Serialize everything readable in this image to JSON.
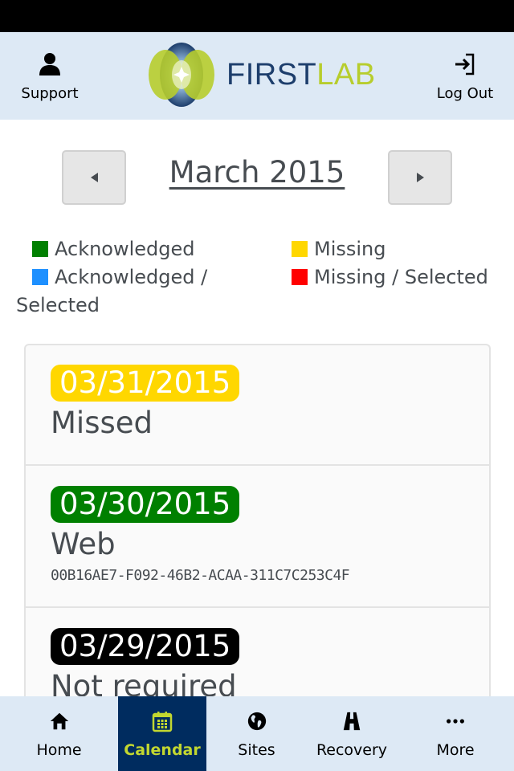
{
  "header": {
    "support_label": "Support",
    "logout_label": "Log Out",
    "logo_first": "FIRST",
    "logo_lab": "LAB"
  },
  "calendar": {
    "month_title": "March 2015",
    "prev_icon": "triangle-left-icon",
    "next_icon": "triangle-right-icon"
  },
  "legend": [
    {
      "label": "Acknowledged",
      "color": "#008000"
    },
    {
      "label": "Missing",
      "color": "#ffd700"
    },
    {
      "label": "Acknowledged / Selected",
      "color": "#1e90ff"
    },
    {
      "label": "Missing / Selected",
      "color": "#ff0000"
    }
  ],
  "entries": [
    {
      "date": "03/31/2015",
      "status": "Missed",
      "detail": "",
      "badge_color": "#ffd700"
    },
    {
      "date": "03/30/2015",
      "status": "Web",
      "detail": "00B16AE7-F092-46B2-ACAA-311C7C253C4F",
      "badge_color": "#008000"
    },
    {
      "date": "03/29/2015",
      "status": "Not required",
      "detail": "",
      "badge_color": "#000000"
    }
  ],
  "tabs": [
    {
      "label": "Home",
      "icon": "home-icon",
      "active": false
    },
    {
      "label": "Calendar",
      "icon": "calendar-icon",
      "active": true
    },
    {
      "label": "Sites",
      "icon": "globe-icon",
      "active": false
    },
    {
      "label": "Recovery",
      "icon": "road-icon",
      "active": false
    },
    {
      "label": "More",
      "icon": "ellipsis-icon",
      "active": false
    }
  ],
  "colors": {
    "header_bg": "#dde9f5",
    "active_tab_bg": "#002c5f",
    "active_tab_fg": "#c2d730",
    "brand_blue": "#1d3e6c",
    "brand_green": "#b7cd2d"
  }
}
